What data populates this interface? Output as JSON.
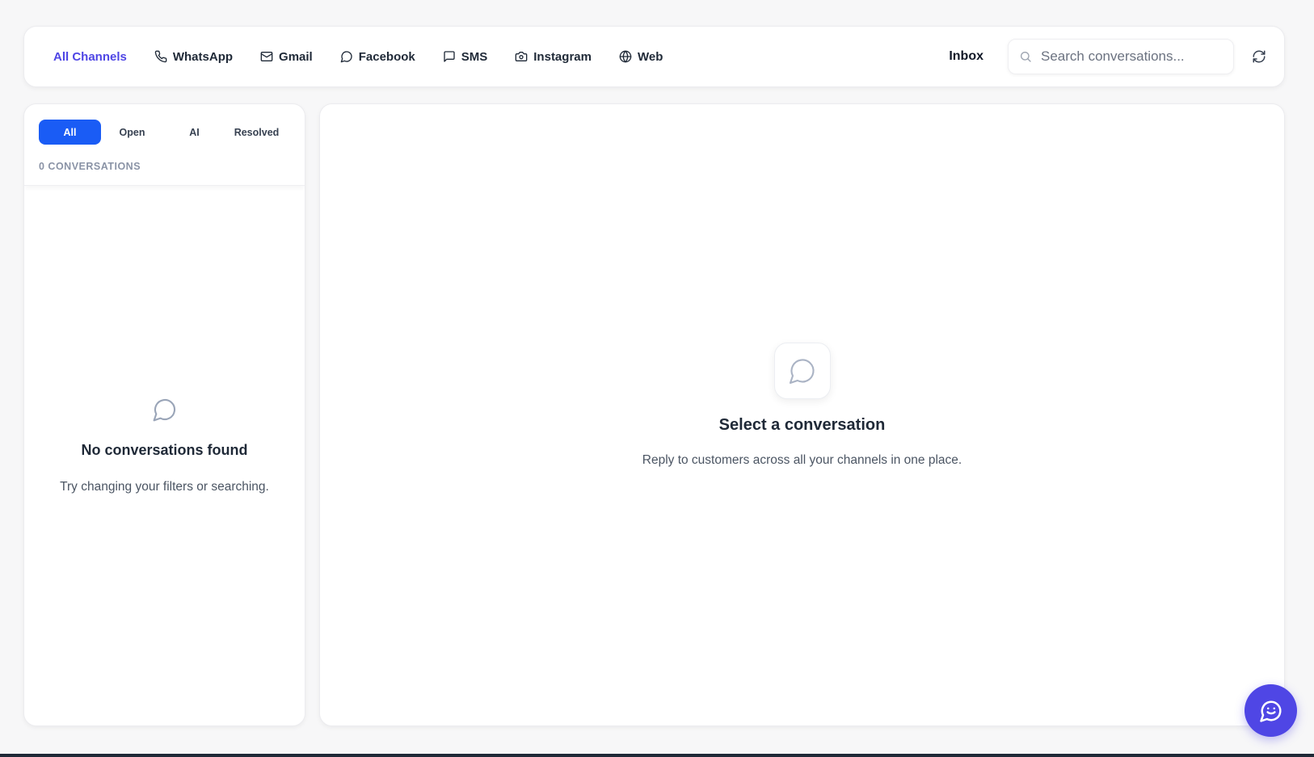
{
  "header": {
    "channels": [
      {
        "label": "All Channels",
        "icon": "none",
        "active": true
      },
      {
        "label": "WhatsApp",
        "icon": "phone-icon"
      },
      {
        "label": "Gmail",
        "icon": "mail-icon"
      },
      {
        "label": "Facebook",
        "icon": "chat-bubble-icon"
      },
      {
        "label": "SMS",
        "icon": "message-square-icon"
      },
      {
        "label": "Instagram",
        "icon": "camera-icon"
      },
      {
        "label": "Web",
        "icon": "globe-icon"
      }
    ],
    "title": "Inbox",
    "search": {
      "placeholder": "Search conversations...",
      "value": ""
    },
    "refresh_icon": "refresh-icon"
  },
  "conversation_list": {
    "tabs": [
      {
        "label": "All",
        "active": true
      },
      {
        "label": "Open"
      },
      {
        "label": "AI"
      },
      {
        "label": "Resolved"
      }
    ],
    "count_label": "0 CONVERSATIONS",
    "empty_state": {
      "icon": "chat-bubble-icon",
      "title": "No conversations found",
      "subtitle": "Try changing your filters or searching."
    }
  },
  "main": {
    "empty_state": {
      "icon": "chat-bubble-icon",
      "title": "Select a conversation",
      "subtitle": "Reply to customers across all your channels in one place."
    }
  },
  "fab": {
    "icon": "chat-support-icon"
  },
  "colors": {
    "accent": "#4f46e5",
    "tab_active": "#1a5cf5",
    "muted_text": "#8a93a6"
  }
}
